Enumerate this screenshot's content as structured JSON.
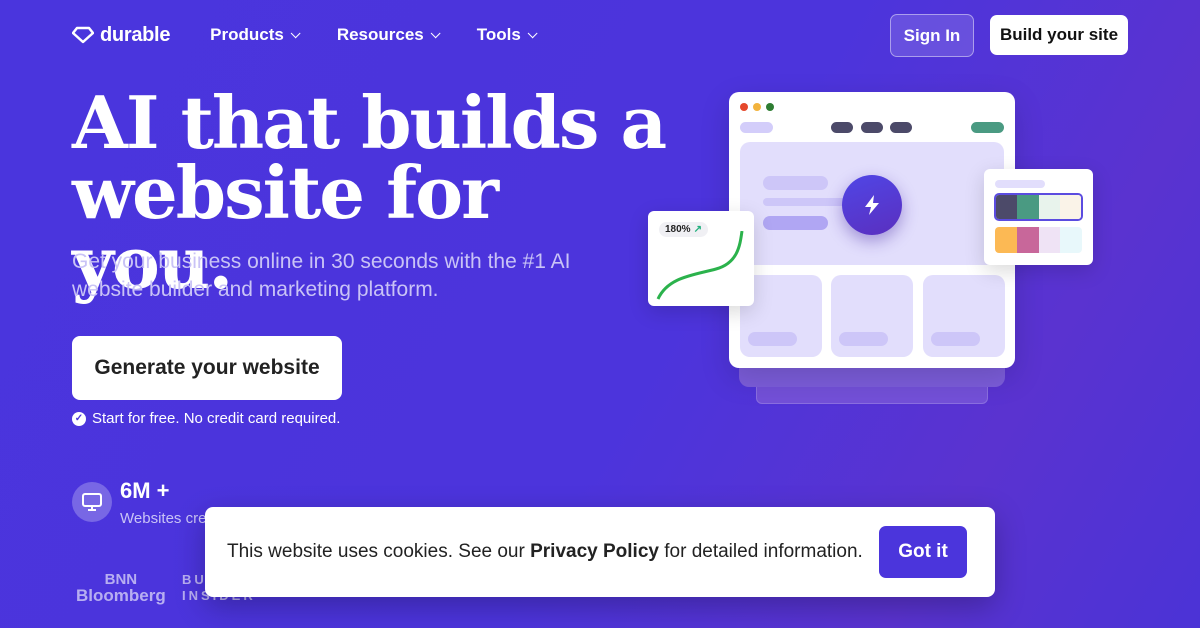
{
  "nav": {
    "brand": "durable",
    "items": [
      {
        "label": "Products"
      },
      {
        "label": "Resources"
      },
      {
        "label": "Tools"
      }
    ],
    "sign_in": "Sign In",
    "build": "Build your site"
  },
  "hero": {
    "title": "AI that builds a website for you.",
    "subtitle": "Get your business online in 30 seconds with the #1 AI website builder and marketing platform.",
    "cta": "Generate your website",
    "note": "Start for free. No credit card required."
  },
  "stat": {
    "value": "6M +",
    "label": "Websites created"
  },
  "press": [
    {
      "line1": "BNN",
      "line2": "Bloomberg"
    },
    {
      "line1": "BUSINESS",
      "line2": "INSIDER"
    }
  ],
  "illustration": {
    "growth": "180%"
  },
  "cookie": {
    "text_before": "This website uses cookies. See our ",
    "link": "Privacy Policy",
    "text_after": " for detailed information.",
    "button": "Got it"
  },
  "colors": {
    "background": "#4b35dc",
    "accent": "#4b35dc",
    "green": "#4a9a82"
  }
}
